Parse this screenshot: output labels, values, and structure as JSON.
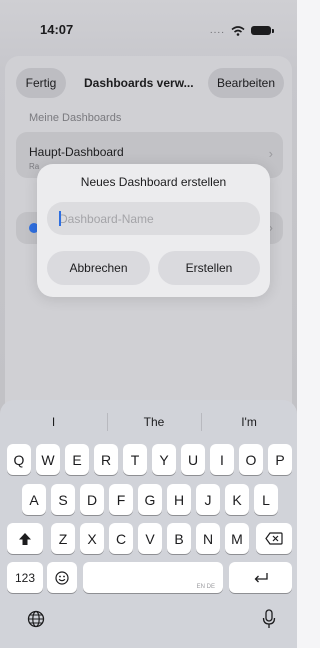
{
  "status_bar": {
    "time": "14:07",
    "signal": "....",
    "wifi_icon": "wifi-icon",
    "battery_icon": "battery-icon"
  },
  "nav": {
    "done_label": "Fertig",
    "title": "Dashboards verw...",
    "edit_label": "Bearbeiten"
  },
  "section": {
    "header": "Meine Dashboards"
  },
  "dashboards": [
    {
      "title": "Haupt-Dashboard",
      "subtitle": "Ra"
    }
  ],
  "alert": {
    "title": "Neues Dashboard erstellen",
    "field_placeholder": "Dashboard-Name",
    "field_value": "",
    "cancel_label": "Abbrechen",
    "create_label": "Erstellen"
  },
  "keyboard": {
    "suggestions": [
      "I",
      "The",
      "I'm"
    ],
    "row1": [
      "Q",
      "W",
      "E",
      "R",
      "T",
      "Y",
      "U",
      "I",
      "O",
      "P"
    ],
    "row2": [
      "A",
      "S",
      "D",
      "F",
      "G",
      "H",
      "J",
      "K",
      "L"
    ],
    "row3": [
      "Z",
      "X",
      "C",
      "V",
      "B",
      "N",
      "M"
    ],
    "numbers_label": "123",
    "language_label": "EN DE",
    "shift_icon": "shift-icon",
    "delete_icon": "delete-icon",
    "emoji_icon": "emoji-icon",
    "return_icon": "return-icon",
    "globe_icon": "globe-icon",
    "mic_icon": "microphone-icon"
  },
  "colors": {
    "accent": "#2f6fe0",
    "sheet": "#d0d0d4",
    "keyboard": "#d1d3d9"
  }
}
